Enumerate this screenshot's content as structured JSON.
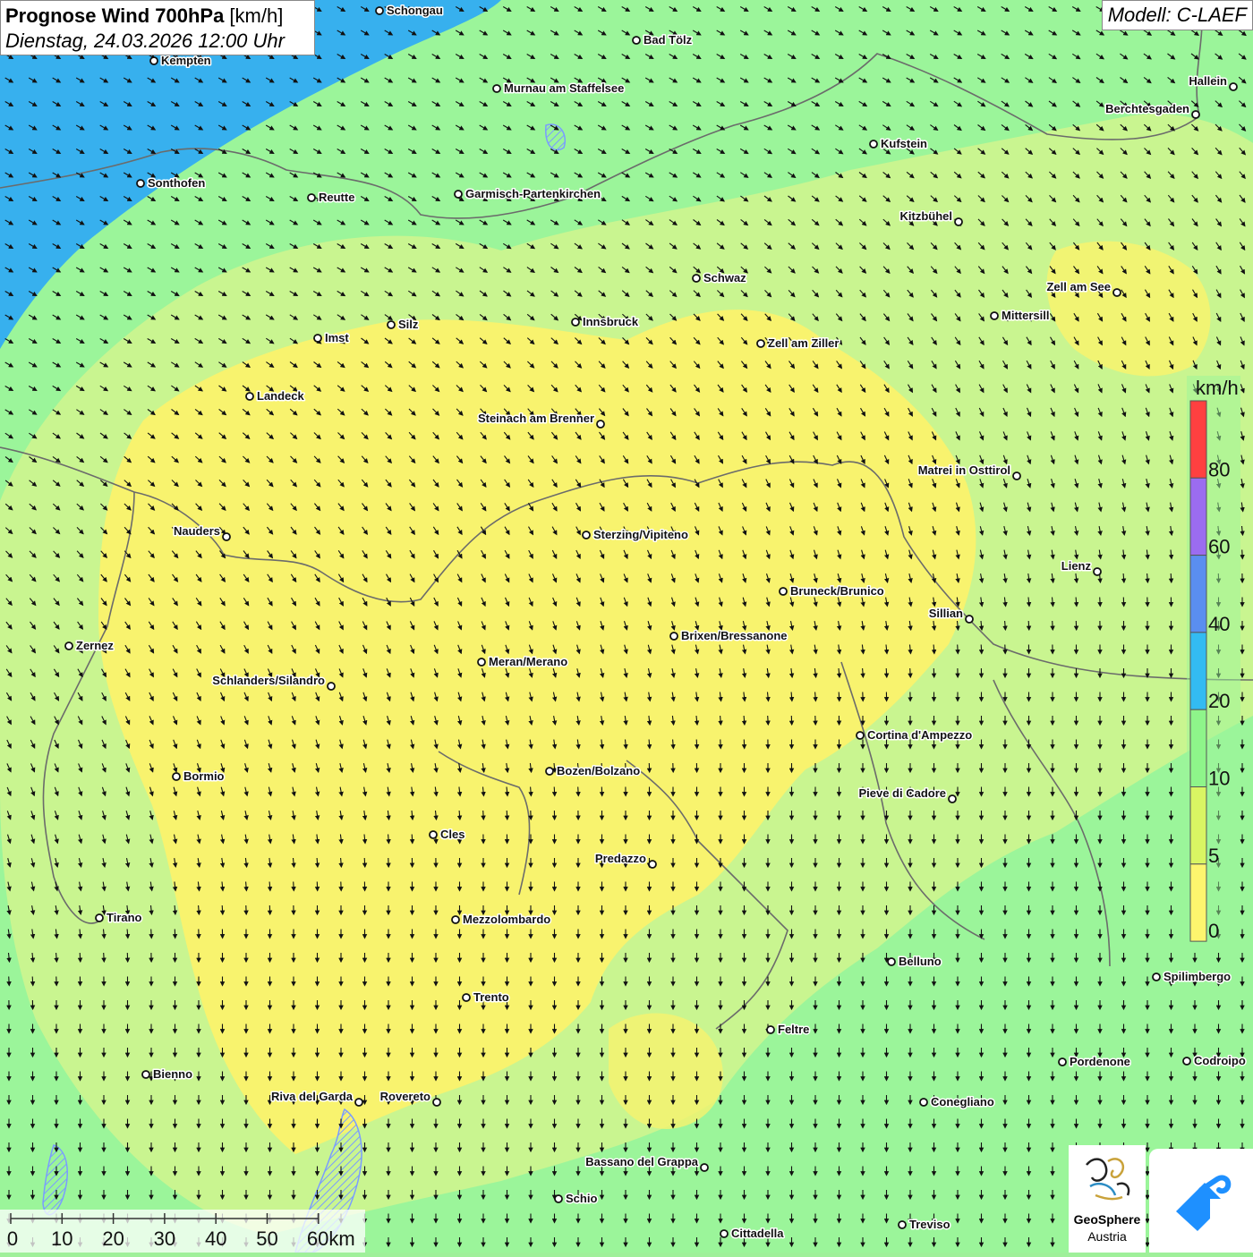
{
  "title": {
    "main_bold": "Prognose Wind 700hPa",
    "main_unit": " [km/h]",
    "subtitle": "Dienstag, 24.03.2026 12:00 Uhr"
  },
  "model_label": "Modell: C-LAEF",
  "legend": {
    "unit": "km/h",
    "ticks": [
      "80",
      "60",
      "40",
      "20",
      "10",
      "5",
      "0"
    ],
    "colors": [
      "#ff4040",
      "#9b6cf0",
      "#5a8ef0",
      "#33bbf2",
      "#8ef58a",
      "#d9f563",
      "#fdf56e"
    ]
  },
  "scale_bar": {
    "labels": [
      "0",
      "10",
      "20",
      "30",
      "40",
      "50",
      "60km"
    ]
  },
  "map_colors": {
    "blue_zone": "#37b0ee",
    "green_zone": "#9bf59a",
    "light_green": "#c7f58c",
    "yellow_zone": "#f8f36e",
    "border": "#6b6b6b",
    "lake": "#88aaff"
  },
  "cities": [
    {
      "name": "Schongau",
      "label_side": "right"
    },
    {
      "name": "Bad Tölz",
      "label_side": "right"
    },
    {
      "name": "Kempten",
      "label_side": "right"
    },
    {
      "name": "Murnau am Staffelsee",
      "label_side": "right"
    },
    {
      "name": "Hallein",
      "label_side": "left"
    },
    {
      "name": "Berchtesgaden",
      "label_side": "left"
    },
    {
      "name": "Kufstein",
      "label_side": "right"
    },
    {
      "name": "Sonthofen",
      "label_side": "right"
    },
    {
      "name": "Reutte",
      "label_side": "right"
    },
    {
      "name": "Garmisch-Partenkirchen",
      "label_side": "right"
    },
    {
      "name": "Kitzbühel",
      "label_side": "left"
    },
    {
      "name": "Schwaz",
      "label_side": "right"
    },
    {
      "name": "Zell am See",
      "label_side": "left"
    },
    {
      "name": "Mittersill",
      "label_side": "right"
    },
    {
      "name": "Silz",
      "label_side": "right"
    },
    {
      "name": "Innsbruck",
      "label_side": "right"
    },
    {
      "name": "Imst",
      "label_side": "right"
    },
    {
      "name": "Zell am Ziller",
      "label_side": "right"
    },
    {
      "name": "Landeck",
      "label_side": "right"
    },
    {
      "name": "Steinach am Brenner",
      "label_side": "left"
    },
    {
      "name": "Matrei in Osttirol",
      "label_side": "left"
    },
    {
      "name": "Nauders",
      "label_side": "left"
    },
    {
      "name": "Sterzing/Vipiteno",
      "label_side": "right"
    },
    {
      "name": "Lienz",
      "label_side": "left"
    },
    {
      "name": "Bruneck/Brunico",
      "label_side": "right"
    },
    {
      "name": "Sillian",
      "label_side": "left"
    },
    {
      "name": "Brixen/Bressanone",
      "label_side": "right"
    },
    {
      "name": "Zernez",
      "label_side": "right"
    },
    {
      "name": "Meran/Merano",
      "label_side": "right"
    },
    {
      "name": "Schlanders/Silandro",
      "label_side": "left"
    },
    {
      "name": "Cortina d'Ampezzo",
      "label_side": "right"
    },
    {
      "name": "Bozen/Bolzano",
      "label_side": "right"
    },
    {
      "name": "Bormio",
      "label_side": "right"
    },
    {
      "name": "Pieve di Cadore",
      "label_side": "left"
    },
    {
      "name": "Cles",
      "label_side": "right"
    },
    {
      "name": "Predazzo",
      "label_side": "left"
    },
    {
      "name": "Tirano",
      "label_side": "right"
    },
    {
      "name": "Mezzolombardo",
      "label_side": "right"
    },
    {
      "name": "Belluno",
      "label_side": "right"
    },
    {
      "name": "Spilimbergo",
      "label_side": "right"
    },
    {
      "name": "Trento",
      "label_side": "right"
    },
    {
      "name": "Feltre",
      "label_side": "right"
    },
    {
      "name": "Pordenone",
      "label_side": "right"
    },
    {
      "name": "Codroipo",
      "label_side": "right"
    },
    {
      "name": "Bienno",
      "label_side": "right"
    },
    {
      "name": "Riva del Garda",
      "label_side": "left"
    },
    {
      "name": "Rovereto",
      "label_side": "left"
    },
    {
      "name": "Conegliano",
      "label_side": "right"
    },
    {
      "name": "Bassano del Grappa",
      "label_side": "left"
    },
    {
      "name": "Schio",
      "label_side": "right"
    },
    {
      "name": "Treviso",
      "label_side": "right"
    },
    {
      "name": "Cittadella",
      "label_side": "right"
    }
  ],
  "logos": {
    "geosphere_line1": "GeoSphere",
    "geosphere_line2": "Austria",
    "geosphere_icon": "geosphere-swirl-icon",
    "app_icon": "wind-app-arrow-icon"
  }
}
